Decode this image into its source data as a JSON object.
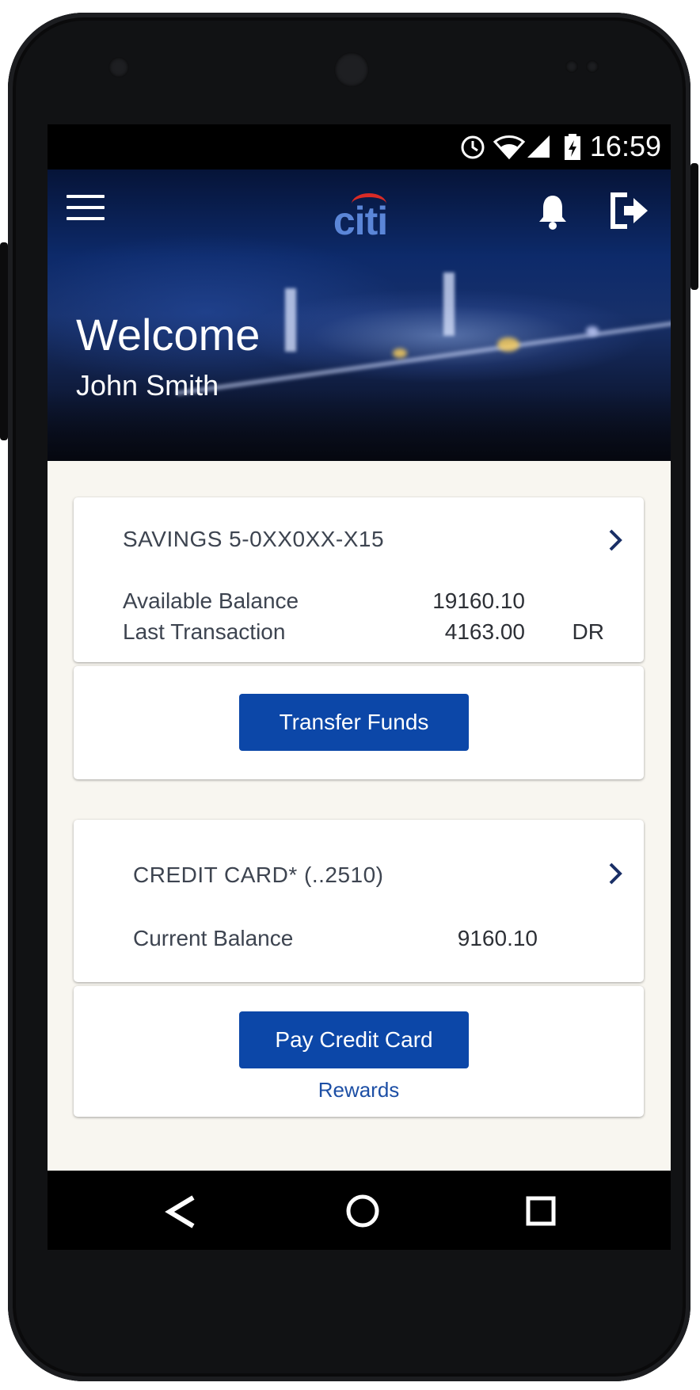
{
  "status_bar": {
    "time": "16:59",
    "icons": [
      "alarm-icon",
      "wifi-icon",
      "signal-icon",
      "battery-icon"
    ]
  },
  "header": {
    "logo": "citi",
    "menu_icon": "hamburger-menu-icon",
    "notification_icon": "bell-icon",
    "logout_icon": "logout-icon",
    "welcome_title": "Welcome",
    "user_name": "John Smith"
  },
  "accounts": [
    {
      "title": "SAVINGS 5-0XX0XX-X15",
      "rows": [
        {
          "label": "Available Balance",
          "value": "19160.10",
          "suffix": ""
        },
        {
          "label": "Last Transaction",
          "value": "4163.00",
          "suffix": "DR"
        }
      ],
      "action_label": "Transfer Funds"
    },
    {
      "title": "CREDIT CARD* (..2510)",
      "rows": [
        {
          "label": "Current Balance",
          "value": "9160.10",
          "suffix": ""
        }
      ],
      "action_label": "Pay Credit Card",
      "link_label": "Rewards"
    }
  ],
  "nav_bar": {
    "back_icon": "back-triangle-icon",
    "home_icon": "home-circle-icon",
    "recents_icon": "recents-square-icon"
  },
  "colors": {
    "primary_button": "#0c47a8",
    "link": "#1d4fa5",
    "page_background": "#f8f6f0",
    "logo_arc": "#d92b26"
  }
}
